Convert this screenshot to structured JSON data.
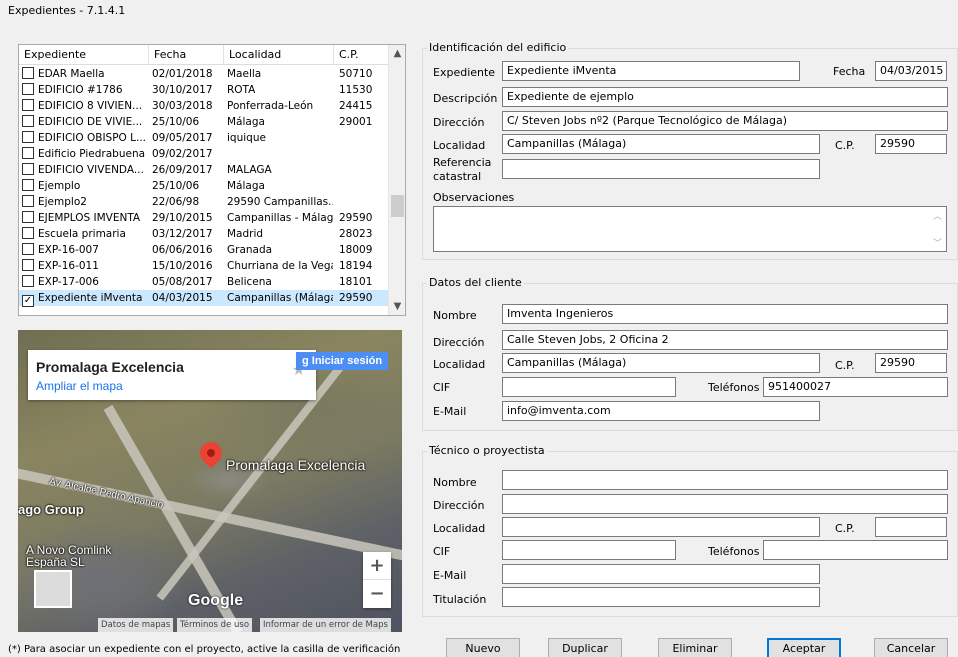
{
  "window": {
    "title": "Expedientes - 7.1.4.1"
  },
  "list": {
    "columns": [
      "Expediente",
      "Fecha",
      "Localidad",
      "C.P."
    ],
    "rows": [
      {
        "checked": false,
        "expediente": "EDAR Maella",
        "fecha": "02/01/2018",
        "localidad": "Maella",
        "cp": "50710"
      },
      {
        "checked": false,
        "expediente": "EDIFICIO #1786",
        "fecha": "30/10/2017",
        "localidad": "ROTA",
        "cp": "11530"
      },
      {
        "checked": false,
        "expediente": "EDIFICIO 8 VIVIEN...",
        "fecha": "30/03/2018",
        "localidad": "Ponferrada-León",
        "cp": "24415"
      },
      {
        "checked": false,
        "expediente": "EDIFICIO DE VIVIE...",
        "fecha": "25/10/06",
        "localidad": "Málaga",
        "cp": "29001"
      },
      {
        "checked": false,
        "expediente": "EDIFICIO OBISPO L...",
        "fecha": "09/05/2017",
        "localidad": "iquique",
        "cp": ""
      },
      {
        "checked": false,
        "expediente": "Edificio Piedrabuena",
        "fecha": "09/02/2017",
        "localidad": "",
        "cp": ""
      },
      {
        "checked": false,
        "expediente": "EDIFICIO VIVENDA...",
        "fecha": "26/09/2017",
        "localidad": "MALAGA",
        "cp": ""
      },
      {
        "checked": false,
        "expediente": "Ejemplo",
        "fecha": "25/10/06",
        "localidad": "Málaga",
        "cp": ""
      },
      {
        "checked": false,
        "expediente": "Ejemplo2",
        "fecha": "22/06/98",
        "localidad": "29590 Campanillas...",
        "cp": ""
      },
      {
        "checked": false,
        "expediente": "EJEMPLOS IMVENTA",
        "fecha": "29/10/2015",
        "localidad": "Campanillas - Málaga",
        "cp": "29590"
      },
      {
        "checked": false,
        "expediente": "Escuela primaria",
        "fecha": "03/12/2017",
        "localidad": "  Madrid",
        "cp": "28023"
      },
      {
        "checked": false,
        "expediente": "EXP-16-007",
        "fecha": "06/06/2016",
        "localidad": "Granada",
        "cp": "18009"
      },
      {
        "checked": false,
        "expediente": "EXP-16-011",
        "fecha": "15/10/2016",
        "localidad": "Churriana de la Vega",
        "cp": "18194"
      },
      {
        "checked": false,
        "expediente": "EXP-17-006",
        "fecha": "05/08/2017",
        "localidad": "Belicena",
        "cp": "18101"
      },
      {
        "checked": true,
        "expediente": "Expediente iMventa",
        "fecha": "04/03/2015",
        "localidad": "Campanillas (Málaga)",
        "cp": "29590"
      }
    ],
    "checkmark": "✓",
    "scroll_up_icon": "▲",
    "scroll_down_icon": "▼"
  },
  "map": {
    "card_title": "Promalaga Excelencia",
    "card_link": "Ampliar el mapa",
    "signin": "Iniciar sesión",
    "pin_label": "Promalaga Excelencia",
    "street_1": "Av. Alcalde Pedro Aparicio",
    "place_1": "ago Group",
    "place_2": "A Novo Comlink España SL",
    "logo": "Google",
    "zoom_in": "+",
    "zoom_out": "−",
    "footer": [
      "Datos de mapas",
      "Términos de uso",
      "Informar de un error de Maps"
    ]
  },
  "note": "(*) Para asociar un expediente con el proyecto, active la casilla de verificación",
  "edificio": {
    "legend": "Identificación del edificio",
    "expediente_label": "Expediente",
    "expediente": "Expediente iMventa",
    "fecha_label": "Fecha",
    "fecha": "04/03/2015",
    "descripcion_label": "Descripción",
    "descripcion": "Expediente de ejemplo",
    "direccion_label": "Dirección",
    "direccion": "C/ Steven Jobs nº2 (Parque Tecnológico de Málaga)",
    "localidad_label": "Localidad",
    "localidad": "Campanillas (Málaga)",
    "cp_label": "C.P.",
    "cp": "29590",
    "referencia_label_1": "Referencia",
    "referencia_label_2": "catastral",
    "referencia": "",
    "observaciones_label": "Observaciones",
    "observaciones": ""
  },
  "cliente": {
    "legend": "Datos del cliente",
    "nombre_label": "Nombre",
    "nombre": "Imventa Ingenieros",
    "direccion_label": "Dirección",
    "direccion": "Calle Steven Jobs, 2 Oficina 2",
    "localidad_label": "Localidad",
    "localidad": "Campanillas (Málaga)",
    "cp_label": "C.P.",
    "cp": "29590",
    "cif_label": "CIF",
    "cif": "",
    "telefonos_label": "Teléfonos",
    "telefonos": "951400027",
    "email_label": "E-Mail",
    "email": "info@imventa.com"
  },
  "tecnico": {
    "legend": "Técnico o proyectista",
    "nombre_label": "Nombre",
    "direccion_label": "Dirección",
    "localidad_label": "Localidad",
    "cp_label": "C.P.",
    "cif_label": "CIF",
    "telefonos_label": "Teléfonos",
    "email_label": "E-Mail",
    "titulacion_label": "Titulación"
  },
  "buttons": {
    "nuevo": "Nuevo",
    "duplicar": "Duplicar",
    "eliminar": "Eliminar",
    "aceptar": "Aceptar",
    "cancelar": "Cancelar"
  }
}
